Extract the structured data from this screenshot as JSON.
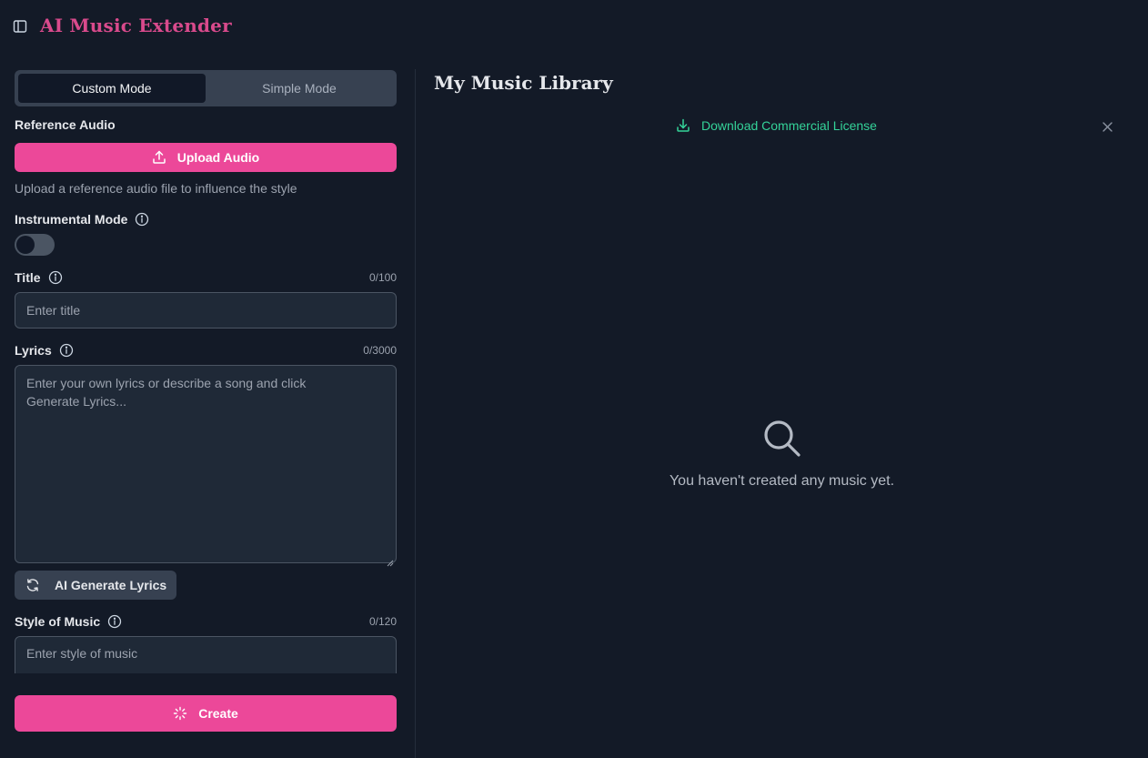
{
  "app": {
    "title": "AI Music Extender"
  },
  "modes": {
    "custom": "Custom Mode",
    "simple": "Simple Mode"
  },
  "reference_audio": {
    "label": "Reference Audio",
    "upload_label": "Upload Audio",
    "hint": "Upload a reference audio file to influence the style"
  },
  "instrumental": {
    "label": "Instrumental Mode",
    "enabled": false
  },
  "title_field": {
    "label": "Title",
    "counter": "0/100",
    "placeholder": "Enter title"
  },
  "lyrics_field": {
    "label": "Lyrics",
    "counter": "0/3000",
    "placeholder": "Enter your own lyrics or describe a song and click Generate Lyrics..."
  },
  "ai_generate": {
    "label": "AI Generate Lyrics"
  },
  "style_field": {
    "label": "Style of Music",
    "counter": "0/120",
    "placeholder": "Enter style of music"
  },
  "create": {
    "label": "Create"
  },
  "library": {
    "title": "My Music Library",
    "license_link": "Download Commercial License",
    "empty_text": "You haven't created any music yet."
  },
  "colors": {
    "background": "#131a27",
    "accent": "#ec4899",
    "brand_title": "#d94a8c",
    "link": "#34d399"
  },
  "icons": {
    "sidebar_toggle": "panel-left-icon",
    "upload": "upload-icon",
    "info": "info-icon",
    "refresh": "refresh-icon",
    "loader": "loader-icon",
    "download": "download-icon",
    "close": "close-icon",
    "search": "search-icon"
  }
}
